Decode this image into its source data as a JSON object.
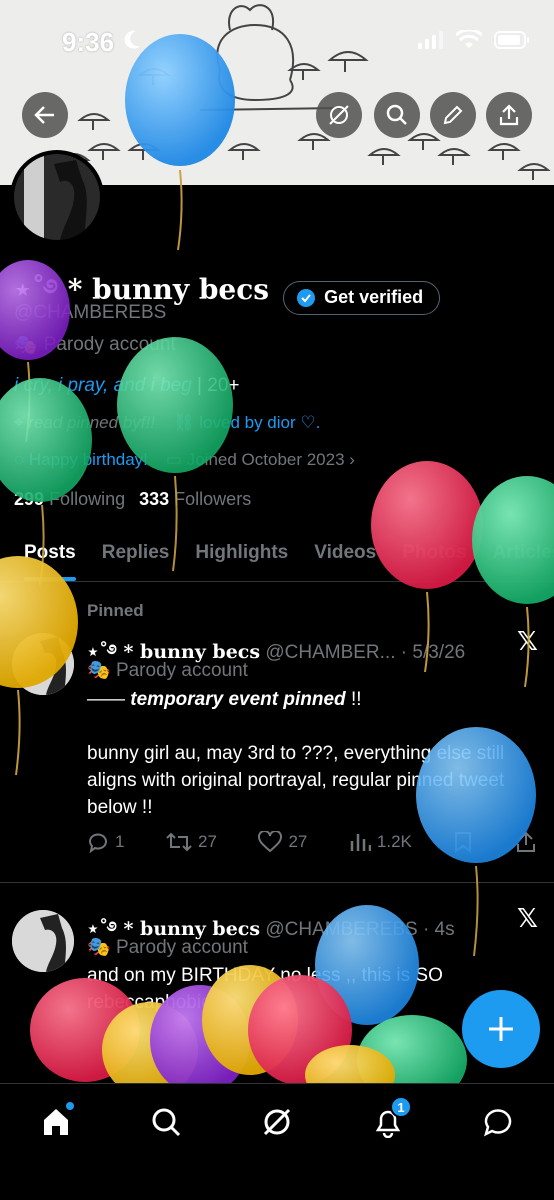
{
  "status_bar": {
    "time": "9:36"
  },
  "profile": {
    "name": "⋆˚࿔ * bunny becs",
    "verify_label": "Get verified",
    "handle": "@CHAMBEREBS",
    "parody_label": "Parody account",
    "bio_italic": "i cry, i pray, and i beg",
    "bio_rest": " | 20+",
    "location": "read pinned byf!!",
    "link_text": "loved  by  dior  ♡.",
    "birthday": "Happy birthday!",
    "joined": "Joined October 2023",
    "following_count": "299",
    "following_label": "Following",
    "followers_count": "333",
    "followers_label": "Followers"
  },
  "tabs": [
    {
      "label": "Posts"
    },
    {
      "label": "Replies"
    },
    {
      "label": "Highlights"
    },
    {
      "label": "Videos"
    },
    {
      "label": "Photos"
    },
    {
      "label": "Articles"
    }
  ],
  "pinned_post": {
    "pinned_label": "Pinned",
    "author": "⋆˚࿔ * bunny becs",
    "handle_time": " @CHAMBER... · 5/3/26",
    "parody_label": "Parody account",
    "line1_prefix": "—— ",
    "line1_italic": "temporary event pinned",
    "line1_suffix": " !!",
    "body": "bunny girl au, may 3rd to ???, everything else still aligns with original portrayal, regular pinned tweet below !!",
    "replies": "1",
    "reposts": "27",
    "likes": "27",
    "views": "1.2K"
  },
  "second_post": {
    "author": "⋆˚࿔ * bunny becs",
    "handle_time": " @CHAMBEREBS · 4s",
    "parody_label": "Parody account",
    "body": "and on my BIRTHDAY no less ,, this is SO rebeccaphobic"
  },
  "nav": {
    "notifications_badge": "1"
  },
  "colors": {
    "accent": "#1d9bf0",
    "background": "#000000",
    "muted": "#71767b"
  },
  "icons": [
    "back-arrow-icon",
    "grok-icon",
    "search-icon",
    "edit-icon",
    "share-icon",
    "verified-badge-icon",
    "parody-mask-icon",
    "location-icon",
    "link-icon",
    "balloon-icon",
    "calendar-icon",
    "reply-icon",
    "repost-icon",
    "like-icon",
    "views-icon",
    "bookmark-icon",
    "x-logo-icon",
    "plus-icon",
    "home-icon",
    "notifications-icon",
    "messages-icon"
  ]
}
